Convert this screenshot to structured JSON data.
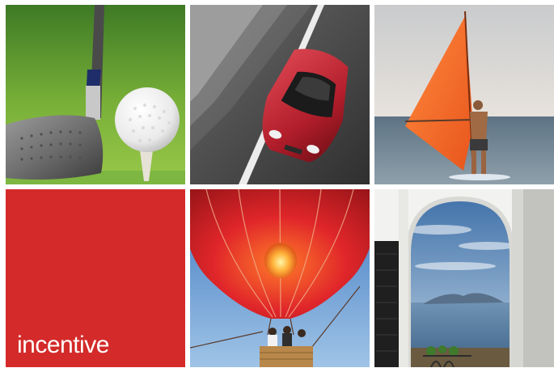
{
  "tiles": [
    {
      "subject": "golf-club-and-ball"
    },
    {
      "subject": "red-sports-car-on-road"
    },
    {
      "subject": "windsurfer-at-sea"
    },
    {
      "subject": "brand-panel"
    },
    {
      "subject": "hot-air-balloon"
    },
    {
      "subject": "arched-window-sea-view"
    }
  ],
  "brand": {
    "label": "incentive"
  },
  "colors": {
    "brand_red": "#d42a2a",
    "text": "#ffffff"
  }
}
